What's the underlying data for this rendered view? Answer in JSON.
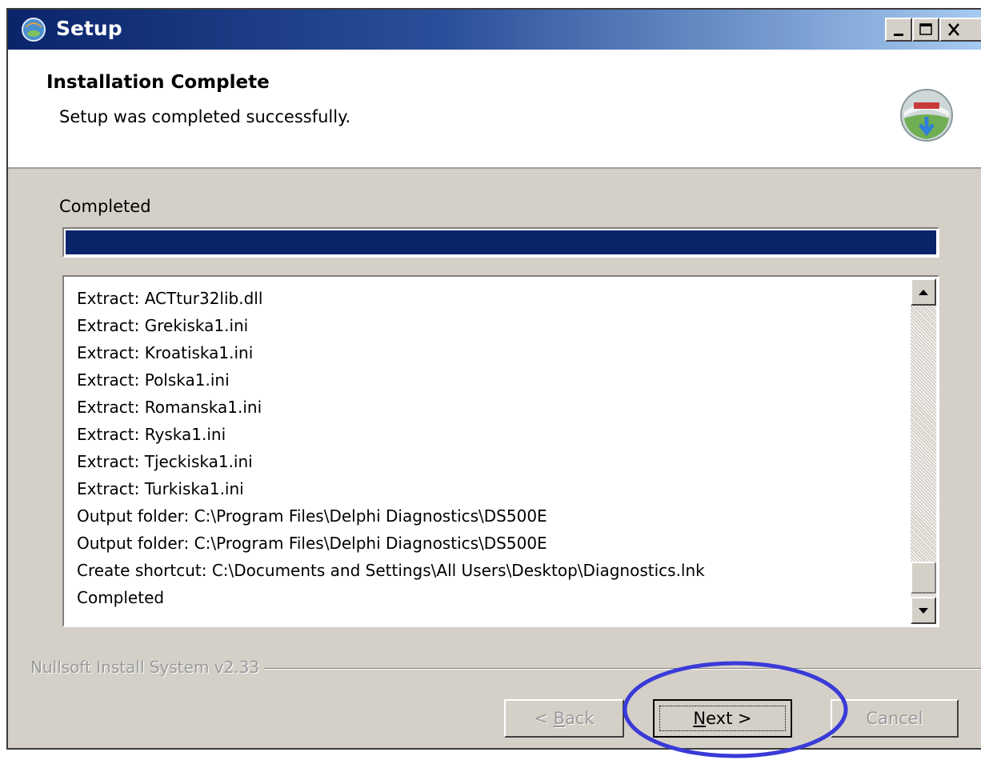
{
  "window": {
    "title": "Setup",
    "controls": [
      "minimize",
      "maximize",
      "close"
    ]
  },
  "header": {
    "title": "Installation Complete",
    "subtitle": "Setup was completed successfully.",
    "icon": "installer-globe-icon"
  },
  "status": {
    "label": "Completed",
    "progress_percent": 100
  },
  "log": {
    "lines": [
      "Extract: ACTtur32lib.dll",
      "Extract: Grekiska1.ini",
      "Extract: Kroatiska1.ini",
      "Extract: Polska1.ini",
      "Extract: Romanska1.ini",
      "Extract: Ryska1.ini",
      "Extract: Tjeckiska1.ini",
      "Extract: Turkiska1.ini",
      "Output folder: C:\\Program Files\\Delphi Diagnostics\\DS500E",
      "Output folder: C:\\Program Files\\Delphi Diagnostics\\DS500E",
      "Create shortcut: C:\\Documents and Settings\\All Users\\Desktop\\Diagnostics.lnk",
      "Completed"
    ],
    "scroll_position": "bottom"
  },
  "footer": {
    "branding": "Nullsoft Install System v2.33",
    "back_label_accel": "B",
    "back_label_prefix": "< ",
    "back_label_rest": "ack",
    "next_label_accel": "N",
    "next_label_rest": "ext >",
    "cancel_label": "Cancel"
  },
  "colors": {
    "titlebar_start": "#0a246a",
    "titlebar_end": "#a6caf0",
    "progress_fill": "#0a246a",
    "dialog_face": "#d4d0c8",
    "highlight_circle": "#3a3ad8"
  }
}
